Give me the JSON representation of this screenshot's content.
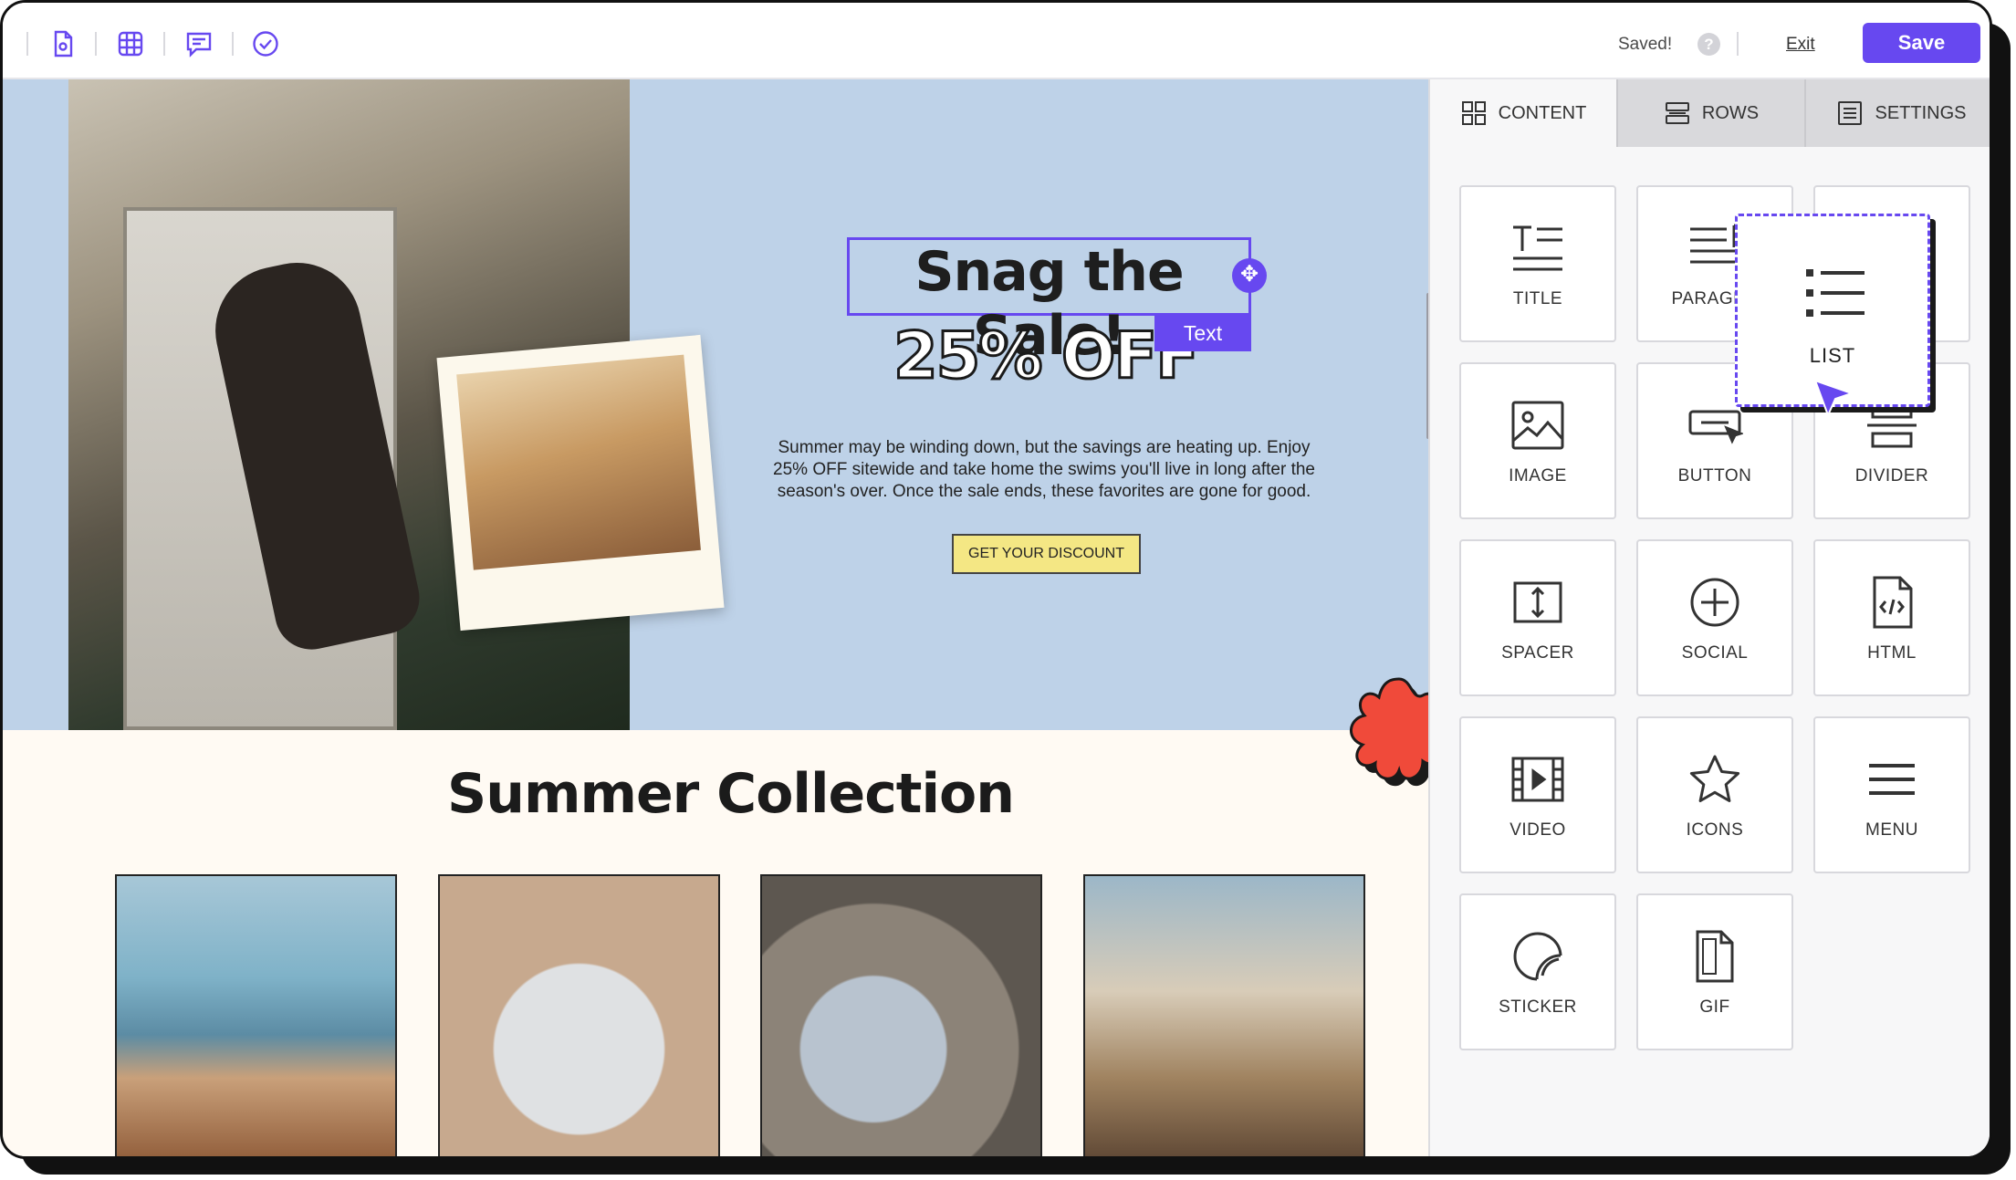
{
  "toolbar": {
    "icons": [
      "document-settings-icon",
      "grid-icon",
      "comment-icon",
      "check-circle-icon"
    ],
    "status": "Saved!",
    "help_label": "?",
    "exit_label": "Exit",
    "save_label": "Save"
  },
  "hero": {
    "headline": "Snag the Sale!",
    "offer": "25% OFF",
    "selection_tag": "Text",
    "body": "Summer may be winding down, but the savings are heating up. Enjoy 25% OFF sitewide and take home the swims you'll live in long after the season's over. Once the sale ends, these favorites are gone for good.",
    "cta_label": "GET YOUR DISCOUNT"
  },
  "collection": {
    "title": "Summer Collection"
  },
  "panel": {
    "tabs": [
      {
        "label": "CONTENT",
        "icon": "layout-grid-icon",
        "active": true
      },
      {
        "label": "ROWS",
        "icon": "rows-icon",
        "active": false
      },
      {
        "label": "SETTINGS",
        "icon": "settings-list-icon",
        "active": false
      }
    ],
    "blocks": [
      {
        "label": "TITLE",
        "icon": "title-icon"
      },
      {
        "label": "PARAGRA",
        "icon": "paragraph-icon"
      },
      {
        "label": "",
        "icon": "list-icon"
      },
      {
        "label": "IMAGE",
        "icon": "image-icon"
      },
      {
        "label": "BUTTON",
        "icon": "button-icon"
      },
      {
        "label": "DIVIDER",
        "icon": "divider-icon"
      },
      {
        "label": "SPACER",
        "icon": "spacer-icon"
      },
      {
        "label": "SOCIAL",
        "icon": "social-icon"
      },
      {
        "label": "HTML",
        "icon": "html-icon"
      },
      {
        "label": "VIDEO",
        "icon": "video-icon"
      },
      {
        "label": "ICONS",
        "icon": "star-icon"
      },
      {
        "label": "MENU",
        "icon": "menu-icon"
      },
      {
        "label": "STICKER",
        "icon": "sticker-icon"
      },
      {
        "label": "GIF",
        "icon": "gif-icon"
      }
    ],
    "dragging_block": {
      "label": "LIST",
      "icon": "list-icon"
    }
  },
  "colors": {
    "accent": "#6748f0",
    "hero_bg": "#bed2e8",
    "cta_bg": "#f4e784",
    "sticker": "#f04a3a"
  }
}
